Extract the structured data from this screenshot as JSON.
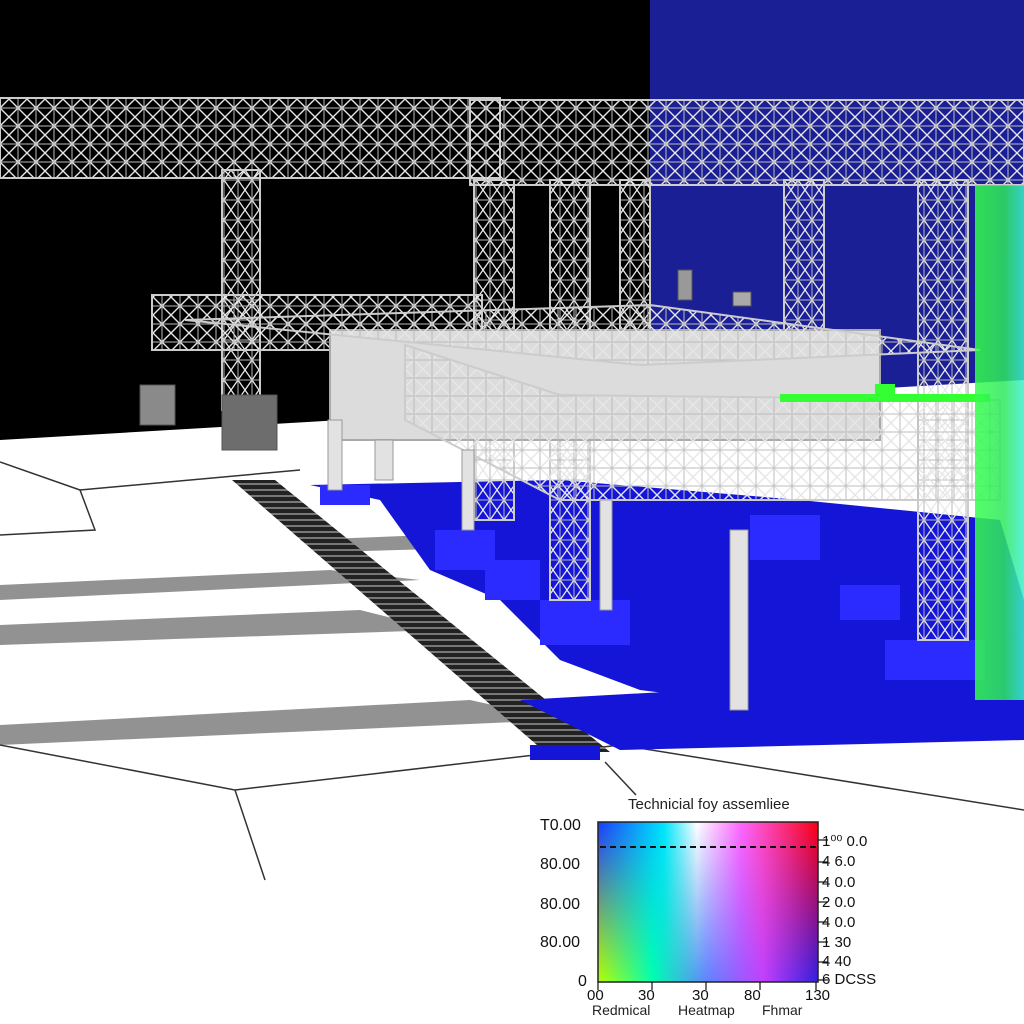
{
  "legend": {
    "title": "Technicial foy assemliee",
    "left_ticks": [
      "T0.00",
      "80.00",
      "80.00",
      "80.00",
      "0"
    ],
    "right_ticks": [
      "1⁰⁰ 0.0",
      "4 6.0",
      "4 0.0",
      "2 0.0",
      "4 0.0",
      "1 30",
      "4 40",
      "6 DCSS"
    ],
    "bottom_ticks": [
      "00",
      "30",
      "30",
      "80",
      "130"
    ],
    "bottom_labels": [
      "Redmical",
      "Heatmap",
      "Fhmar"
    ]
  },
  "colors": {
    "sky_left": "#000000",
    "sky_right": "#1a1f96",
    "floor": "#ffffff",
    "truss": "#d9d9d9",
    "water": "#1515d8",
    "green_beam": "#33ff33"
  }
}
